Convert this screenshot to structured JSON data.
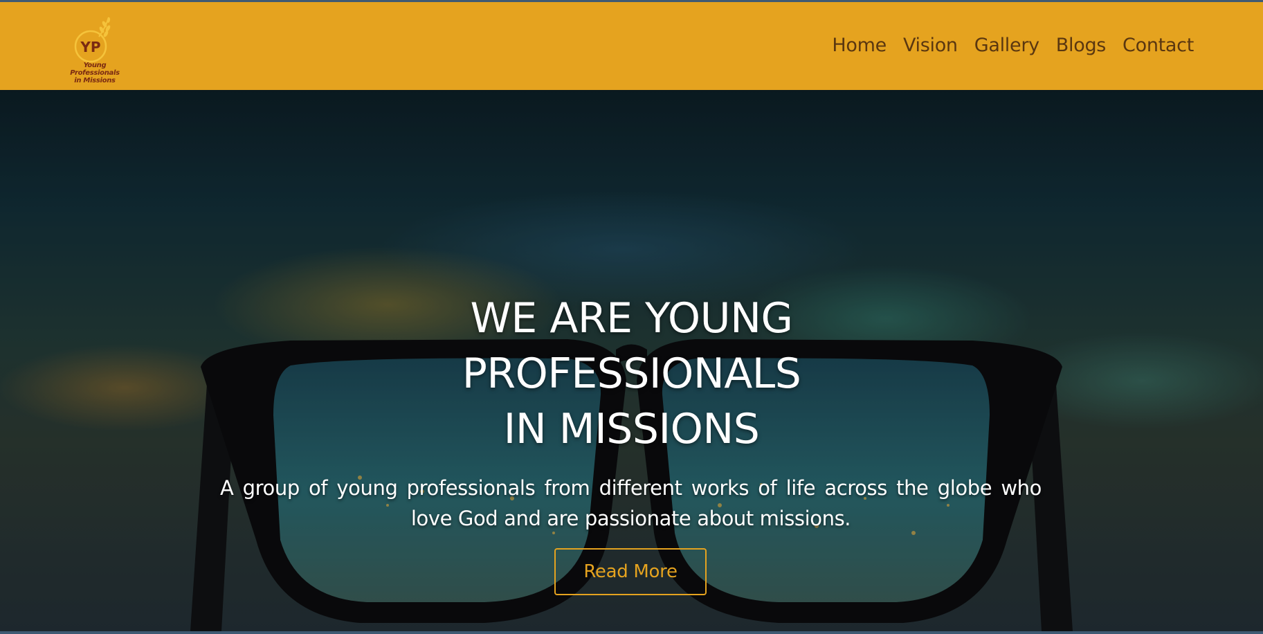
{
  "brand": {
    "monogram": "YP",
    "name_line1": "Young Professionals",
    "name_line2": "in Missions",
    "color": "#7a2a12",
    "header_color": "#e5a31f"
  },
  "nav": {
    "items": [
      {
        "label": "Home"
      },
      {
        "label": "Vision"
      },
      {
        "label": "Gallery"
      },
      {
        "label": "Blogs"
      },
      {
        "label": "Contact"
      }
    ]
  },
  "hero": {
    "title_line1": "WE ARE YOUNG",
    "title_line2": "PROFESSIONALS",
    "title_line3": "IN MISSIONS",
    "text": "A group of young professionals from different works of life across the globe who love God and are passionate about missions.",
    "button_label": "Read More",
    "accent_color": "#e5a31f"
  }
}
